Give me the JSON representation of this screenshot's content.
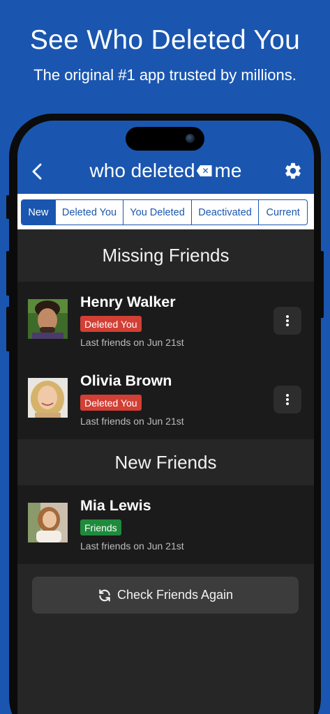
{
  "promo": {
    "title": "See Who Deleted You",
    "subtitle": "The original #1 app trusted by millions."
  },
  "header": {
    "logo_left": "who deleted",
    "logo_x": "✕",
    "logo_right": "me",
    "back_icon": "chevron-left-icon",
    "settings_icon": "gear-icon"
  },
  "tabs": [
    {
      "label": "New",
      "active": true
    },
    {
      "label": "Deleted You",
      "active": false
    },
    {
      "label": "You Deleted",
      "active": false
    },
    {
      "label": "Deactivated",
      "active": false
    },
    {
      "label": "Current",
      "active": false
    }
  ],
  "sections": {
    "missing_title": "Missing Friends",
    "new_title": "New Friends"
  },
  "missing_friends": [
    {
      "name": "Henry Walker",
      "status": "Deleted You",
      "last_seen": "Last friends on Jun 21st"
    },
    {
      "name": "Olivia Brown",
      "status": "Deleted You",
      "last_seen": "Last friends on Jun 21st"
    }
  ],
  "new_friends": [
    {
      "name": "Mia Lewis",
      "status": "Friends",
      "last_seen": "Last friends on Jun 21st"
    }
  ],
  "actions": {
    "check_again": "Check Friends Again",
    "check_icon": "refresh-icon"
  },
  "colors": {
    "brand_blue": "#1a56b0",
    "deleted_red": "#d23f34",
    "friends_green": "#1f8a3c",
    "row_bg": "#1b1b1c",
    "screen_bg": "#262627"
  }
}
